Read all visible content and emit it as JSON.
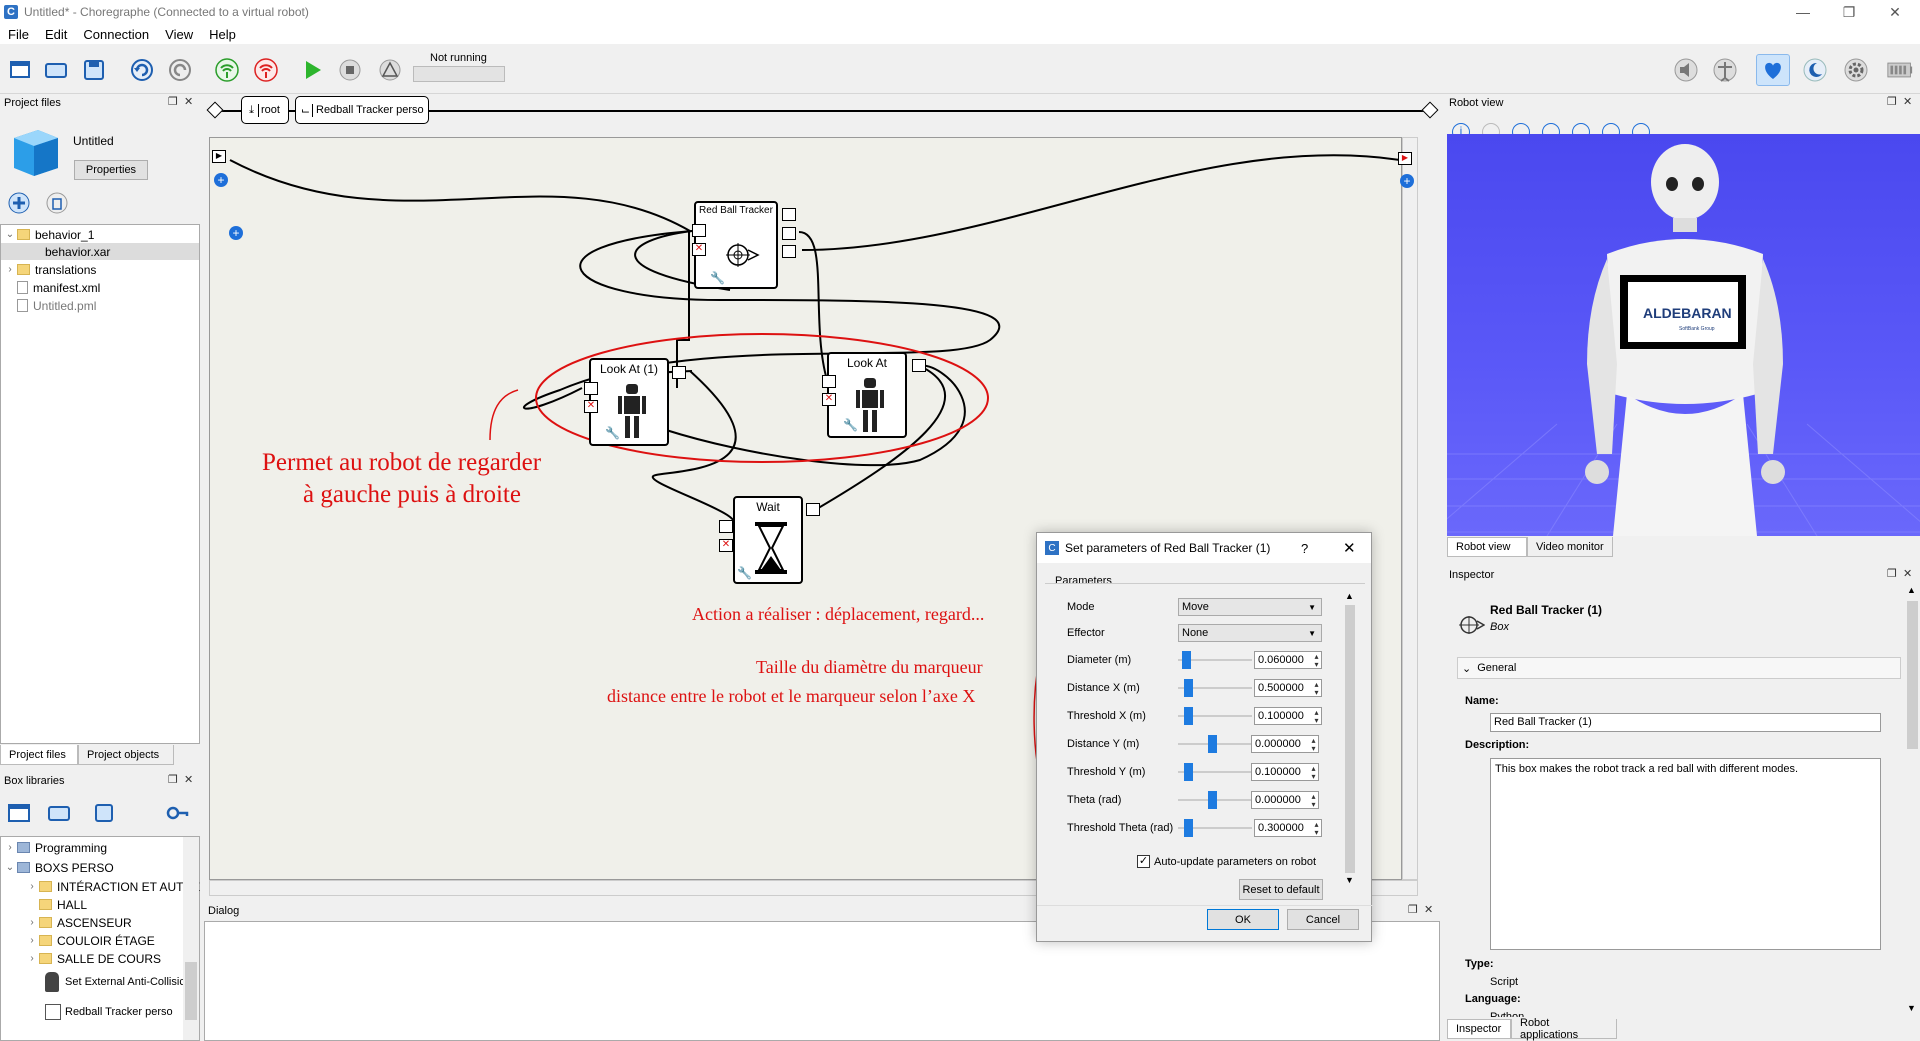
{
  "window": {
    "title": "Untitled* - Choregraphe (Connected to a virtual robot)",
    "app_icon": "C"
  },
  "menu": [
    "File",
    "Edit",
    "Connection",
    "View",
    "Help"
  ],
  "toolbar": {
    "run_state": "Not running"
  },
  "project_files": {
    "header": "Project files",
    "project_name": "Untitled",
    "properties_label": "Properties",
    "tree": [
      {
        "label": "behavior_1",
        "type": "folder"
      },
      {
        "label": "behavior.xar",
        "type": "file"
      },
      {
        "label": "translations",
        "type": "folder"
      },
      {
        "label": "manifest.xml",
        "type": "file"
      },
      {
        "label": "Untitled.pml",
        "type": "file"
      }
    ],
    "tabs": [
      "Project files",
      "Project objects"
    ]
  },
  "box_libraries": {
    "header": "Box libraries",
    "tree": [
      {
        "label": "Programming"
      },
      {
        "label": "BOXS PERSO"
      },
      {
        "label": "INTÉRACTION ET AUTRE"
      },
      {
        "label": "HALL"
      },
      {
        "label": "ASCENSEUR"
      },
      {
        "label": "COULOIR ÉTAGE"
      },
      {
        "label": "SALLE DE COURS"
      },
      {
        "label": "Set External Anti-Collisic"
      },
      {
        "label": "Redball Tracker perso"
      }
    ]
  },
  "breadcrumb": {
    "root": "root",
    "current": "Redball Tracker perso"
  },
  "flow": {
    "boxes": {
      "red_ball_tracker": "Red Ball Tracker",
      "look_at_1": "Look At (1)",
      "look_at": "Look At",
      "wait": "Wait"
    }
  },
  "annotations": {
    "left_line1": "Permet au robot de regarder",
    "left_line2": "à gauche puis à droite",
    "action": "Action a réaliser : déplacement, regard...",
    "diameter": "Taille du diamètre du marqueur",
    "distance": "distance entre le robot et le marqueur selon l’axe X"
  },
  "dialog_panel": {
    "header": "Dialog"
  },
  "params_dialog": {
    "title": "Set parameters of Red Ball Tracker (1)",
    "help": "?",
    "group": "Parameters",
    "rows": [
      {
        "label": "Mode",
        "value": "Move"
      },
      {
        "label": "Effector",
        "value": "None"
      },
      {
        "label": "Diameter (m)",
        "value": "0.060000"
      },
      {
        "label": "Distance X (m)",
        "value": "0.500000"
      },
      {
        "label": "Threshold X (m)",
        "value": "0.100000"
      },
      {
        "label": "Distance Y (m)",
        "value": "0.000000"
      },
      {
        "label": "Threshold Y (m)",
        "value": "0.100000"
      },
      {
        "label": "Theta (rad)",
        "value": "0.000000"
      },
      {
        "label": "Threshold Theta (rad)",
        "value": "0.300000"
      }
    ],
    "auto_update": "Auto-update parameters on robot",
    "reset": "Reset to default",
    "ok": "OK",
    "cancel": "Cancel"
  },
  "robot_view": {
    "header": "Robot view",
    "tablet_text": "ALDEBARAN",
    "tablet_sub": "SoftBank Group",
    "tabs": [
      "Robot view",
      "Video monitor"
    ]
  },
  "inspector": {
    "header": "Inspector",
    "box_name": "Red Ball Tracker (1)",
    "box_kind": "Box",
    "section": "General",
    "name_label": "Name:",
    "name_value": "Red Ball Tracker (1)",
    "desc_label": "Description:",
    "desc_value": "This box makes the robot track a red ball with different modes.",
    "type_label": "Type:",
    "type_value": "Script",
    "lang_label": "Language:",
    "lang_value": "Python",
    "tabs": [
      "Inspector",
      "Robot applications"
    ]
  },
  "colors": {
    "annotation": "#d11",
    "accent": "#1e7be0",
    "robot_bg": "#4a48ef"
  }
}
